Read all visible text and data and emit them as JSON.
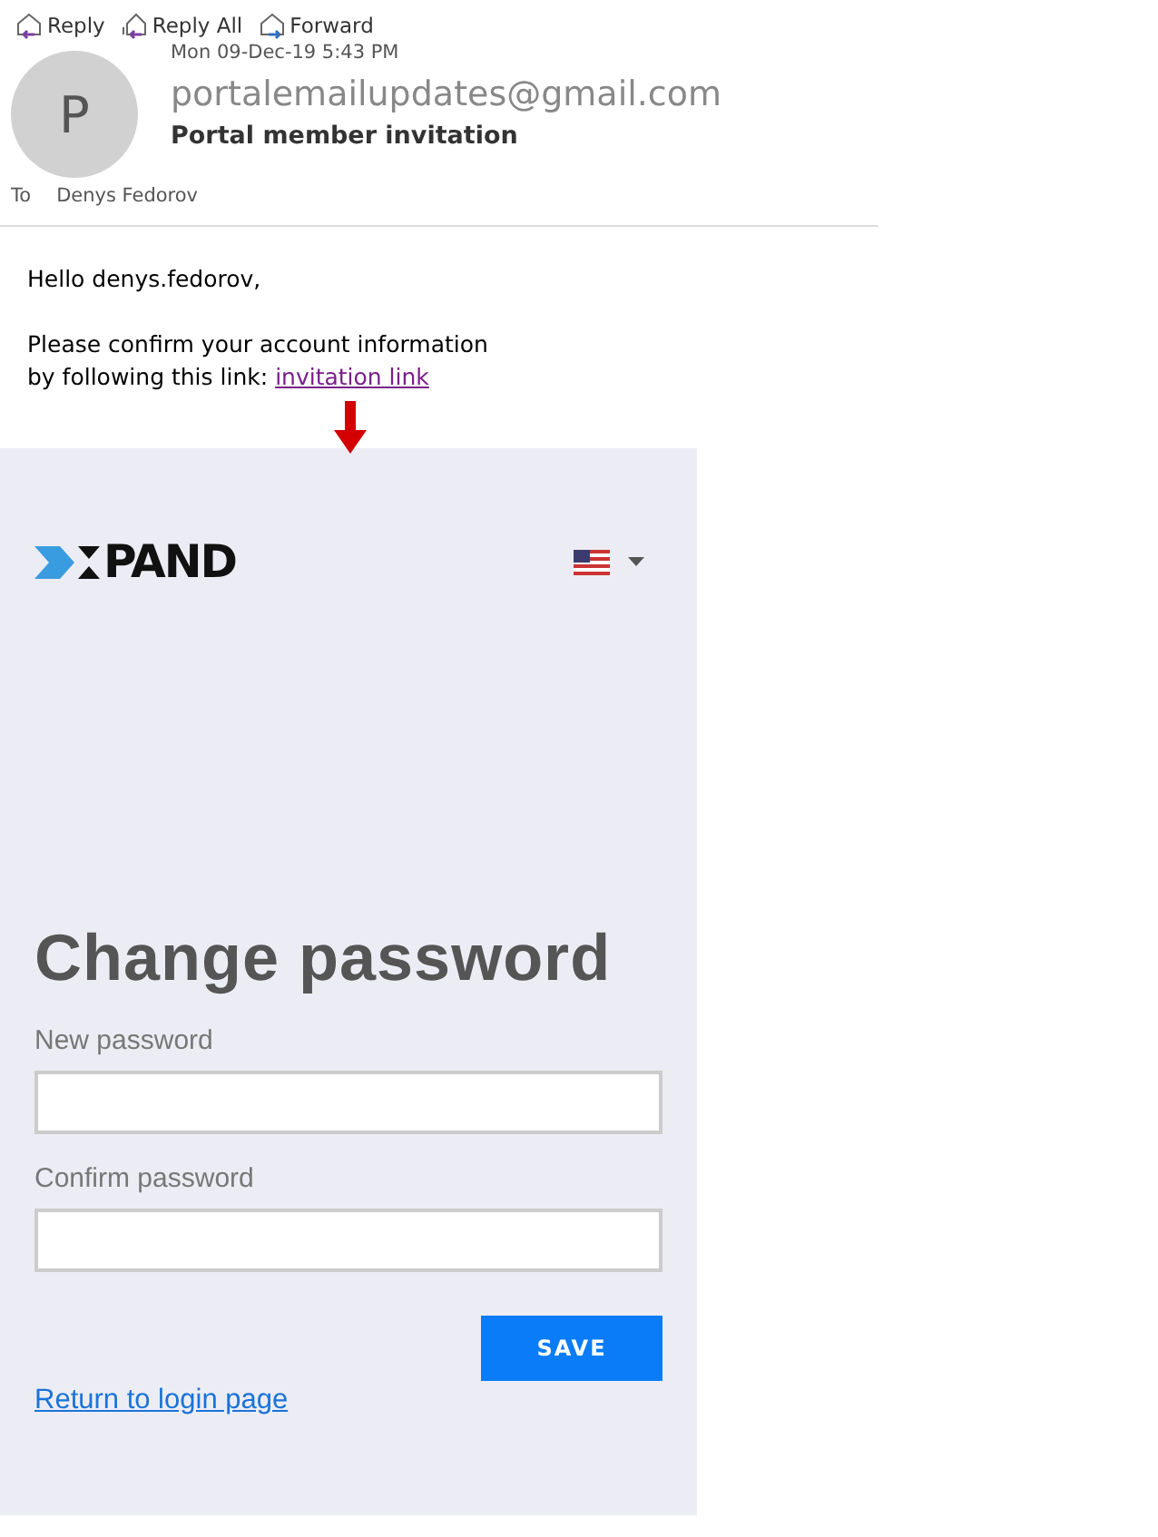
{
  "email": {
    "actions": [
      {
        "kind": "reply",
        "label": "Reply"
      },
      {
        "kind": "reply_all",
        "label": "Reply All"
      },
      {
        "kind": "forward",
        "label": "Forward"
      }
    ],
    "avatar_letter": "P",
    "date": "Mon 09-Dec-19 5:43 PM",
    "sender": "portalemailupdates@gmail.com",
    "subject": "Portal member invitation",
    "to_label": "To",
    "to": "Denys Fedorov",
    "greeting": "Hello denys.fedorov,",
    "body_line_1": "Please confirm your account information",
    "body_line_2": "by following this link:",
    "link": "invitation link"
  },
  "portal": {
    "logo_text": "PAND",
    "title": "Change password",
    "fields": [
      {
        "label": "New password"
      },
      {
        "label": "Confirm password"
      }
    ],
    "save_button": "SAVE",
    "return_link": "Return to login page"
  }
}
